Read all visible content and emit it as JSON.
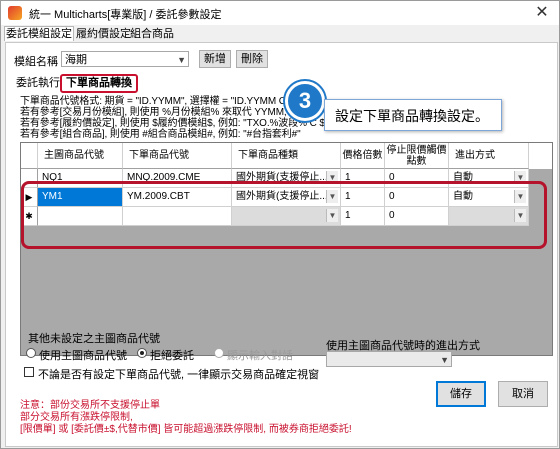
{
  "window": {
    "title": "統一 Multicharts[專業版] / 委託參數設定",
    "close_glyph": "✕"
  },
  "menu_tabs": [
    "委託模組設定",
    "履約價設定",
    "組合商品"
  ],
  "module": {
    "label": "模組名稱",
    "value": "海期",
    "add_button": "新增",
    "delete_button": "刪除"
  },
  "sub_tabs": [
    "委託執行",
    "下單商品轉換"
  ],
  "callout": {
    "badge": "3",
    "text": "設定下單商品轉換設定。"
  },
  "hint_lines": [
    "下單商品代號格式: 期貨 = \"ID.YYMM\", 選擇權 = \"ID.YYMM C 履約價\"",
    "若有參考[交易月份模組], 則使用 %月份模組% 來取代 YYMM, 例如: \"TXF.%波段%\"",
    "若有參考[履約價設定], 則使用 $履約價模組$, 例如: \"TXO.%波段% C $TXO$\"",
    "若有參考[組合商品], 則使用 #組合商品模組#, 例如: \"#台指套利#\""
  ],
  "grid": {
    "headers": [
      "主圖商品代號",
      "下單商品代號",
      "下單商品種類",
      "價格倍數",
      "停止限價觸價點數",
      "進出方式"
    ],
    "rows": [
      {
        "marker": "",
        "main": "NQ1",
        "order": "MNQ.2009.CME",
        "kind": "國外期貨(支援停止...",
        "mult": "1",
        "ticks": "0",
        "mode": "自動",
        "selected": false
      },
      {
        "marker": "▶",
        "main": "YM1",
        "order": "YM.2009.CBT",
        "kind": "國外期貨(支援停止...",
        "mult": "1",
        "ticks": "0",
        "mode": "自動",
        "selected": true
      },
      {
        "marker": "✱",
        "main": "",
        "order": "",
        "kind": "",
        "mult": "1",
        "ticks": "0",
        "mode": "",
        "selected": false
      }
    ]
  },
  "other_group": {
    "title": "其他未設定之主圖商品代號",
    "options": [
      "使用主圖商品代號",
      "拒絕委託",
      "顯示輸入對話"
    ],
    "selected_index": 1
  },
  "exit_mode": {
    "label": "使用主圖商品代號時的進出方式",
    "value": ""
  },
  "checkbox_label": "不論是否有設定下單商品代號, 一律顯示交易商品確定視窗",
  "notes": [
    "注意：部份交易所不支援停止單",
    "部分交易所有漲跌停限制,",
    "[限價單] 或 [委託價±$,代替市價] 皆可能超過漲跌停限制, 而被券商拒絕委託!"
  ],
  "buttons": {
    "save": "儲存",
    "cancel": "取消"
  },
  "colors": {
    "accent": "#0078d7",
    "highlight": "#b5122b",
    "note": "#c8102e",
    "badge": "#1f78c8"
  }
}
